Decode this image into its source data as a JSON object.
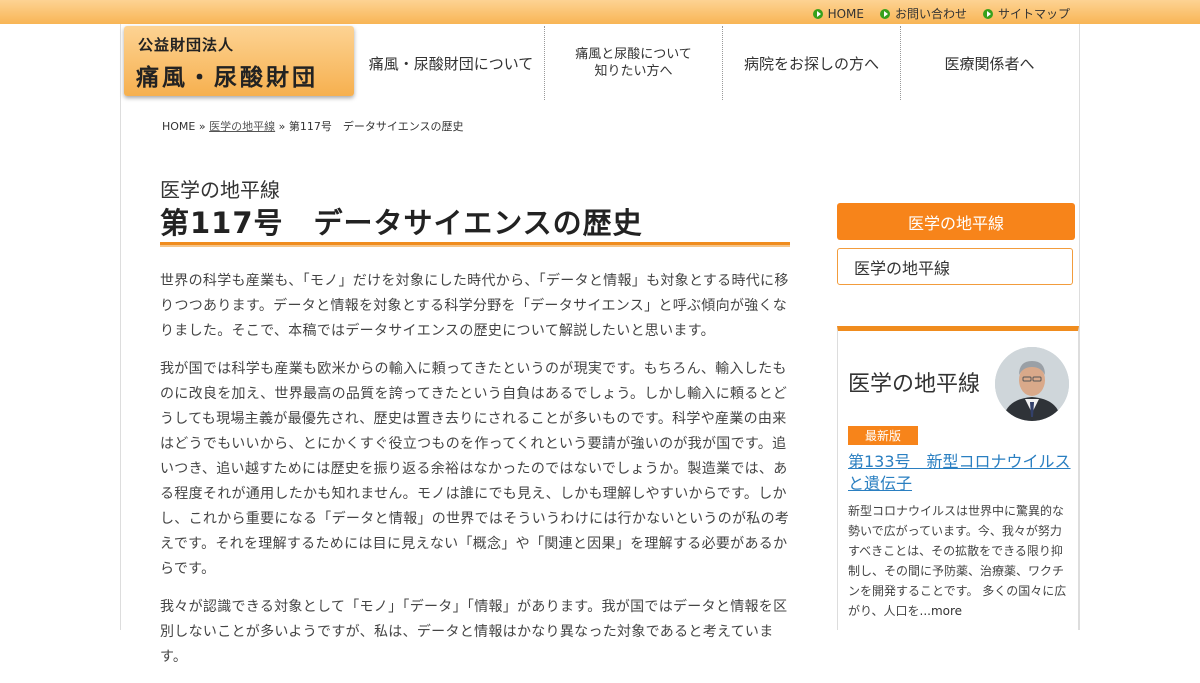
{
  "topbar": {
    "links": [
      "HOME",
      "お問い合わせ",
      "サイトマップ"
    ]
  },
  "logo": {
    "subtitle": "公益財団法人",
    "title": "痛風・尿酸財団"
  },
  "nav": {
    "item1": "痛風・尿酸財団について",
    "item2_line1": "痛風と尿酸について",
    "item2_line2": "知りたい方へ",
    "item3": "病院をお探しの方へ",
    "item4": "医療関係者へ"
  },
  "breadcrumb": {
    "home": "HOME",
    "sep": "»",
    "category": "医学の地平線",
    "current": "第117号　データサイエンスの歴史"
  },
  "article": {
    "category": "医学の地平線",
    "title": "第117号　データサイエンスの歴史",
    "paragraphs": [
      "世界の科学も産業も、「モノ」だけを対象にした時代から、「データと情報」も対象とする時代に移りつつあります。データと情報を対象とする科学分野を「データサイエンス」と呼ぶ傾向が強くなりました。そこで、本稿ではデータサイエンスの歴史について解説したいと思います。",
      "我が国では科学も産業も欧米からの輸入に頼ってきたというのが現実です。もちろん、輸入したものに改良を加え、世界最高の品質を誇ってきたという自負はあるでしょう。しかし輸入に頼るとどうしても現場主義が最優先され、歴史は置き去りにされることが多いものです。科学や産業の由来はどうでもいいから、とにかくすぐ役立つものを作ってくれという要請が強いのが我が国です。追いつき、追い越すためには歴史を振り返る余裕はなかったのではないでしょうか。製造業では、ある程度それが通用したかも知れません。モノは誰にでも見え、しかも理解しやすいからです。しかし、これから重要になる「データと情報」の世界ではそういうわけには行かないというのが私の考えです。それを理解するためには目に見えない「概念」や「関連と因果」を理解する必要があるからです。",
      "我々が認識できる対象として「モノ」「データ」「情報」があります。我が国ではデータと情報を区別しないことが多いようですが、私は、データと情報はかなり異なった対象であると考えています。"
    ]
  },
  "sidebar": {
    "tab_label": "医学の地平線",
    "link_label": "医学の地平線",
    "box_title": "医学の地平線",
    "badge": "最新版",
    "latest_title": "第133号　新型コロナウイルスと遺伝子",
    "excerpt": "新型コロナウイルスは世界中に驚異的な勢いで広がっています。今、我々が努力すべきことは、その拡散をできる限り抑制し、その間に予防薬、治療薬、ワクチンを開発することです。 多くの国々に広がり、人口を",
    "more": "...more"
  },
  "colors": {
    "accent": "#f7841a",
    "topbar": "#f8b555",
    "link": "#2a7fc1",
    "bullet": "#37a01c"
  }
}
